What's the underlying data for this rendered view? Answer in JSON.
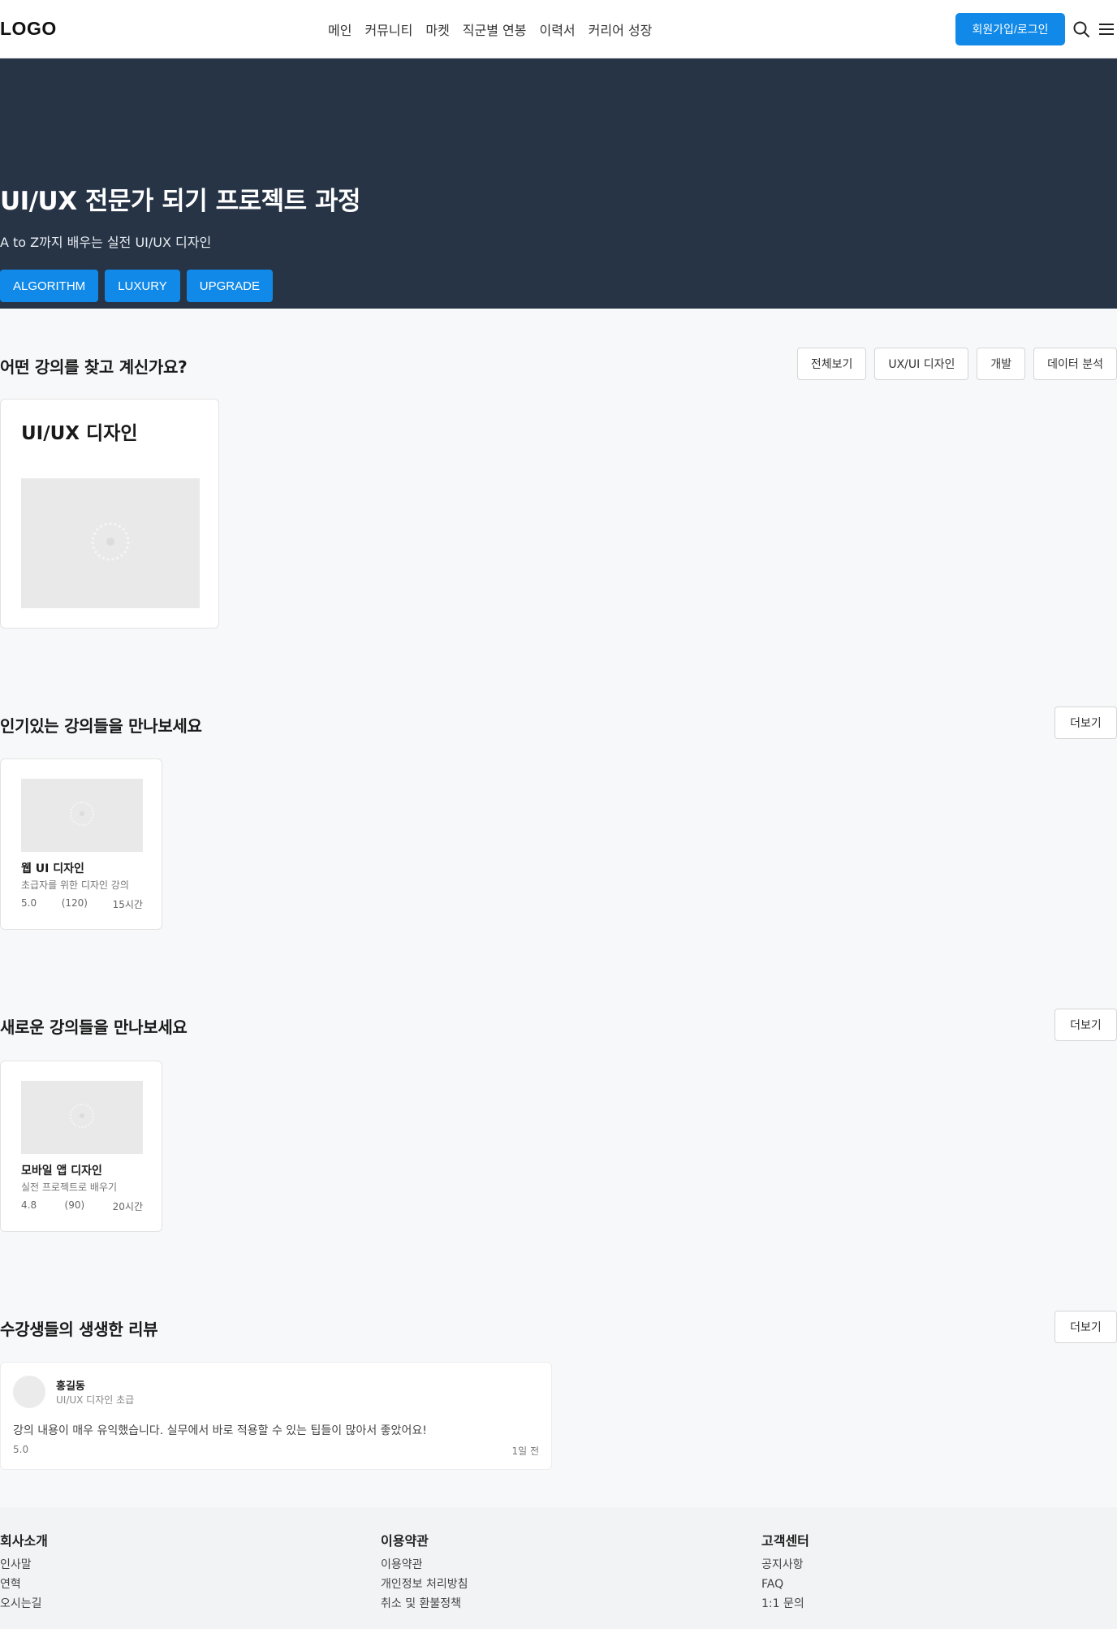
{
  "header": {
    "logo": "LOGO",
    "nav": [
      "메인",
      "커뮤니티",
      "마켓",
      "직군별 연봉",
      "이력서",
      "커리어 성장"
    ],
    "join_label": "회원가입/로그인"
  },
  "hero": {
    "title": "UI/UX 전문가 되기 프로젝트 과정",
    "subtitle": "A to Z까지 배우는 실전 UI/UX 디자인",
    "tags": [
      "ALGORITHM",
      "LUXURY",
      "UPGRADE"
    ]
  },
  "categories_section": {
    "title": "어떤 강의를 찾고 계신가요?",
    "filters": [
      "전체보기",
      "UX/UI 디자인",
      "개발",
      "데이터 분석"
    ],
    "card_title": "UI/UX 디자인"
  },
  "popular_section": {
    "title": "인기있는 강의들을 만나보세요",
    "more_label": "더보기",
    "course": {
      "title": "웹 UI 디자인",
      "desc": "초급자를 위한 디자인 강의",
      "rating": "5.0",
      "reviews": "(120)",
      "hours": "15시간"
    }
  },
  "new_section": {
    "title": "새로운 강의들을 만나보세요",
    "more_label": "더보기",
    "course": {
      "title": "모바일 앱 디자인",
      "desc": "실전 프로젝트로 배우기",
      "rating": "4.8",
      "reviews": "(90)",
      "hours": "20시간"
    }
  },
  "reviews_section": {
    "title": "수강생들의 생생한 리뷰",
    "more_label": "더보기",
    "review": {
      "name": "홍길동",
      "course": "UI/UX 디자인 초급",
      "text": "강의 내용이 매우 유익했습니다. 실무에서 바로 적용할 수 있는 팁들이 많아서 좋았어요!",
      "rating": "5.0",
      "date": "1일 전"
    }
  },
  "footer": {
    "columns": [
      {
        "title": "회사소개",
        "links": [
          "인사말",
          "연혁",
          "오시는길"
        ]
      },
      {
        "title": "이용약관",
        "links": [
          "이용약관",
          "개인정보 처리방침",
          "취소 및 환불정책"
        ]
      },
      {
        "title": "고객센터",
        "links": [
          "공지사항",
          "FAQ",
          "1:1 문의"
        ]
      }
    ]
  },
  "colors": {
    "accent": "#1089e8",
    "hero_bg": "#273446",
    "page_bg": "#f7f8f9"
  },
  "icons": [
    "search-icon",
    "menu-icon",
    "image-placeholder-icon"
  ]
}
